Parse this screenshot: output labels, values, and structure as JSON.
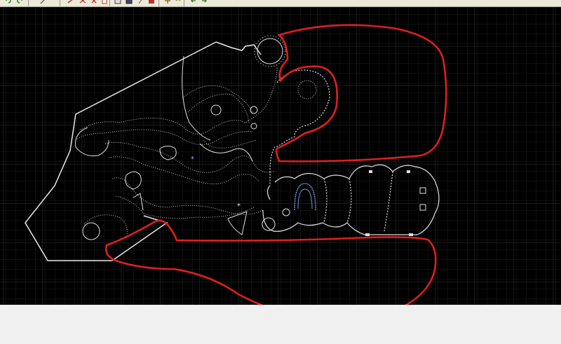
{
  "toolbar": {
    "items": [
      {
        "name": "undo-icon"
      },
      {
        "name": "redo-icon"
      },
      {
        "name": "select-arrow-icon"
      },
      {
        "name": "draw-line-icon"
      },
      {
        "name": "move-icon"
      },
      {
        "name": "delete-icon"
      },
      {
        "name": "properties-icon"
      },
      {
        "name": "layers-icon"
      },
      {
        "name": "save-icon"
      },
      {
        "name": "wand-icon"
      },
      {
        "name": "palette-icon"
      },
      {
        "name": "rotate-icon"
      },
      {
        "name": "refresh-icon"
      }
    ]
  },
  "colors": {
    "canvas_bg": "#000000",
    "grid_minor": "#1e1e1e",
    "grid_major": "#333333",
    "map_lines": "#e8e8e8",
    "map_blue": "#7f8fd0",
    "annotation": "#e01e1e",
    "toolbar_bg": "#ece9d8",
    "panel_bg": "#f0f0f0"
  }
}
